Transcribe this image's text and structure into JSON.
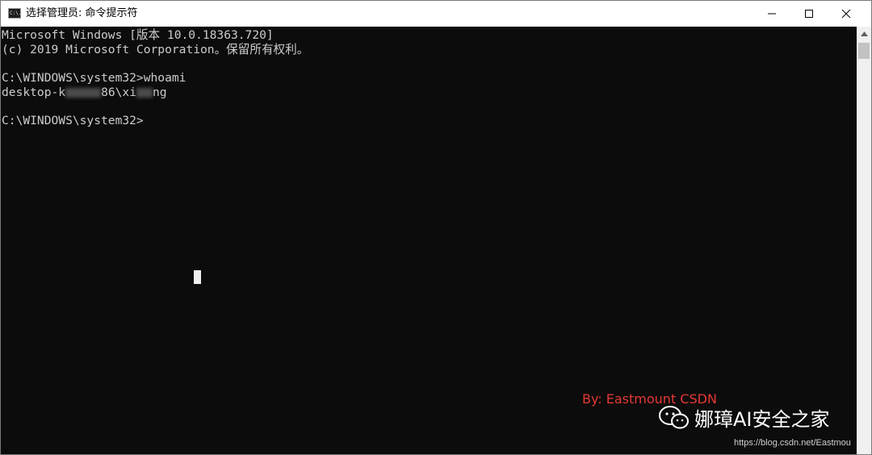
{
  "window": {
    "title": "选择管理员: 命令提示符",
    "icon": "cmd-icon",
    "icon_glyph": "C:\\."
  },
  "console": {
    "lines": [
      "Microsoft Windows [版本 10.0.18363.720]",
      "(c) 2019 Microsoft Corporation。保留所有权利。",
      "",
      "C:\\WINDOWS\\system32>whoami",
      "",
      "",
      "C:\\WINDOWS\\system32>"
    ],
    "user_line": {
      "part1": "desktop-k",
      "part2": "86\\xi",
      "part3": "ng"
    }
  },
  "watermark": {
    "by": "By: Eastmount CSDN",
    "brand": "娜璋AI安全之家",
    "url": "https://blog.csdn.net/Eastmou"
  },
  "colors": {
    "console_bg": "#0c0c0c",
    "console_text": "#cccccc",
    "watermark_red": "#e53935"
  }
}
